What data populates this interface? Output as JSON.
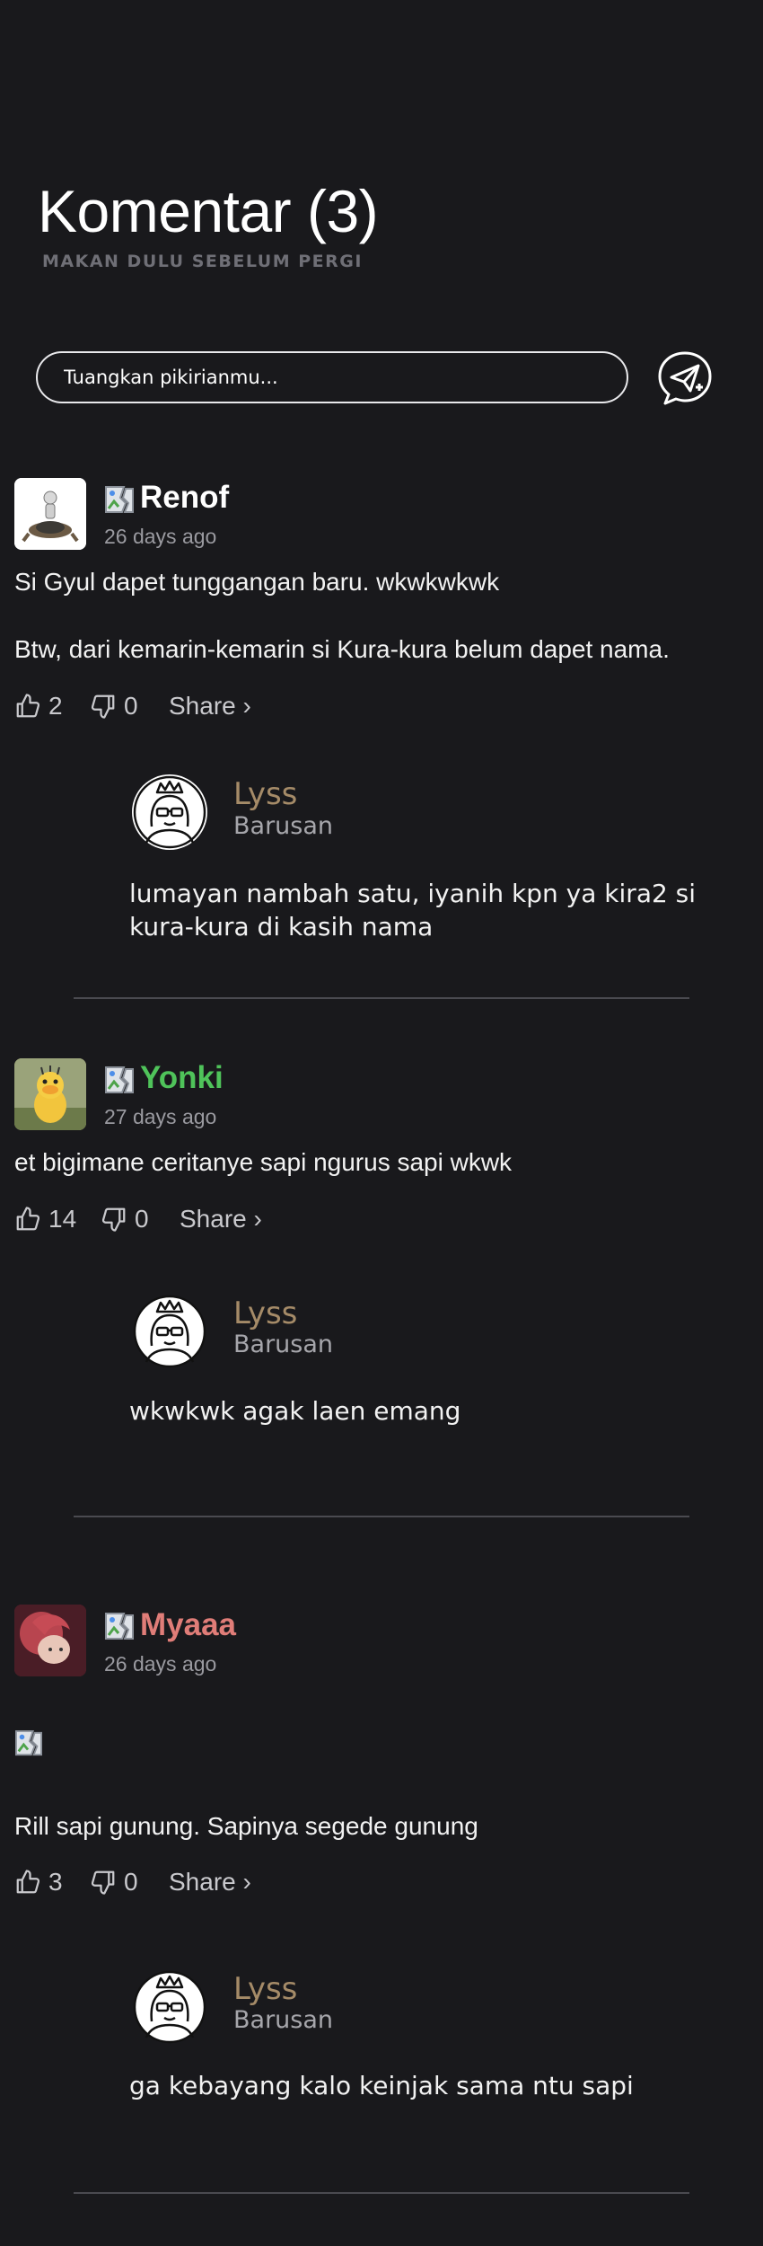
{
  "header": {
    "title": "Komentar (3)",
    "subtitle": "MAKAN DULU SEBELUM PERGI"
  },
  "composer": {
    "placeholder": "Tuangkan pikirianmu...",
    "send_icon": "send-message-icon"
  },
  "comments": [
    {
      "username": "Renof",
      "username_color": "#ffffff",
      "time": "26 days ago",
      "lines": [
        "Si Gyul dapet tunggangan baru. wkwkwkwk",
        "Btw, dari kemarin-kemarin si Kura-kura belum dapet nama."
      ],
      "likes": "2",
      "dislikes": "0",
      "share_label": "Share ›",
      "reply": {
        "name": "Lyss",
        "time": "Barusan",
        "text": "lumayan nambah satu, iyanih kpn ya kira2 si kura-kura di kasih nama"
      }
    },
    {
      "username": "Yonki",
      "username_color": "#4fc35a",
      "time": "27 days ago",
      "lines": [
        "et bigimane ceritanye sapi ngurus sapi wkwk"
      ],
      "likes": "14",
      "dislikes": "0",
      "share_label": "Share ›",
      "reply": {
        "name": "Lyss",
        "time": "Barusan",
        "text": "wkwkwk agak laen emang"
      }
    },
    {
      "username": "Myaaa",
      "username_color": "#e07d78",
      "time": "26 days ago",
      "lines": [
        "Rill sapi gunung. Sapinya segede gunung"
      ],
      "likes": "3",
      "dislikes": "0",
      "share_label": "Share ›",
      "reply": {
        "name": "Lyss",
        "time": "Barusan",
        "text": "ga kebayang kalo keinjak sama ntu sapi"
      }
    }
  ]
}
